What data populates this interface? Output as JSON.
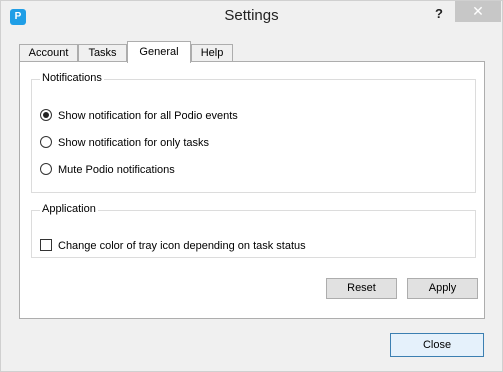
{
  "window": {
    "title": "Settings",
    "help_glyph": "?",
    "close_glyph": "✕",
    "app_icon_glyph": "P"
  },
  "tabs": [
    {
      "label": "Account",
      "active": false
    },
    {
      "label": "Tasks",
      "active": false
    },
    {
      "label": "General",
      "active": true
    },
    {
      "label": "Help",
      "active": false
    }
  ],
  "notifications": {
    "title": "Notifications",
    "options": [
      {
        "label": "Show notification for all Podio events",
        "checked": true
      },
      {
        "label": "Show notification for only tasks",
        "checked": false
      },
      {
        "label": "Mute Podio notifications",
        "checked": false
      }
    ]
  },
  "application": {
    "title": "Application",
    "tray_option": {
      "label": "Change color of tray icon depending on task status",
      "checked": false
    }
  },
  "buttons": {
    "reset": "Reset",
    "apply": "Apply",
    "close": "Close"
  }
}
